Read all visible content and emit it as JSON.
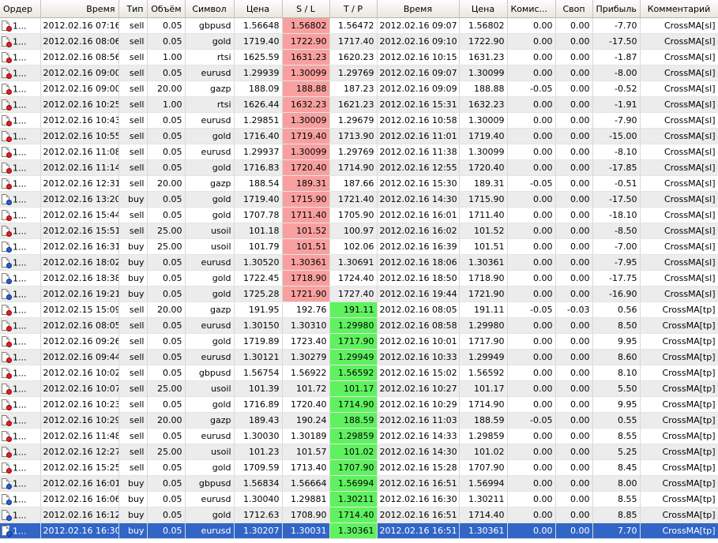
{
  "columns": {
    "order": "Ордер",
    "open_time": "Время",
    "type": "Тип",
    "volume": "Объём",
    "symbol": "Символ",
    "open_price": "Цена",
    "sl": "S / L",
    "tp": "T / P",
    "close_time": "Время",
    "close_price": "Цена",
    "commission": "Комис...",
    "swap": "Своп",
    "profit": "Прибыль",
    "comment": "Комментарий"
  },
  "colors": {
    "sl_hit": "#f8a0a0",
    "tp_hit": "#5ff25f",
    "selected_row": "#3165c6",
    "sell_icon": "#e02020",
    "buy_icon": "#2060e0"
  },
  "rows": [
    {
      "order": "1...",
      "open_time": "2012.02.16 07:16",
      "type": "sell",
      "volume": "0.05",
      "symbol": "gbpusd",
      "open_price": "1.56648",
      "sl": "1.56802",
      "tp": "1.56472",
      "close_time": "2012.02.16 09:07",
      "close_price": "1.56802",
      "commission": "0.00",
      "swap": "0.00",
      "profit": "-7.70",
      "comment": "CrossMA[sl]",
      "hit": "sl"
    },
    {
      "order": "1...",
      "open_time": "2012.02.16 08:06",
      "type": "sell",
      "volume": "0.05",
      "symbol": "gold",
      "open_price": "1719.40",
      "sl": "1722.90",
      "tp": "1717.40",
      "close_time": "2012.02.16 09:10",
      "close_price": "1722.90",
      "commission": "0.00",
      "swap": "0.00",
      "profit": "-17.50",
      "comment": "CrossMA[sl]",
      "hit": "sl"
    },
    {
      "order": "1...",
      "open_time": "2012.02.16 08:56",
      "type": "sell",
      "volume": "1.00",
      "symbol": "rtsi",
      "open_price": "1625.59",
      "sl": "1631.23",
      "tp": "1620.23",
      "close_time": "2012.02.16 10:15",
      "close_price": "1631.23",
      "commission": "0.00",
      "swap": "0.00",
      "profit": "-1.87",
      "comment": "CrossMA[sl]",
      "hit": "sl"
    },
    {
      "order": "1...",
      "open_time": "2012.02.16 09:00",
      "type": "sell",
      "volume": "0.05",
      "symbol": "eurusd",
      "open_price": "1.29939",
      "sl": "1.30099",
      "tp": "1.29769",
      "close_time": "2012.02.16 09:07",
      "close_price": "1.30099",
      "commission": "0.00",
      "swap": "0.00",
      "profit": "-8.00",
      "comment": "CrossMA[sl]",
      "hit": "sl"
    },
    {
      "order": "1...",
      "open_time": "2012.02.16 09:00",
      "type": "sell",
      "volume": "20.00",
      "symbol": "gazp",
      "open_price": "188.09",
      "sl": "188.88",
      "tp": "187.23",
      "close_time": "2012.02.16 09:09",
      "close_price": "188.88",
      "commission": "-0.05",
      "swap": "0.00",
      "profit": "-0.52",
      "comment": "CrossMA[sl]",
      "hit": "sl"
    },
    {
      "order": "1...",
      "open_time": "2012.02.16 10:25",
      "type": "sell",
      "volume": "1.00",
      "symbol": "rtsi",
      "open_price": "1626.44",
      "sl": "1632.23",
      "tp": "1621.23",
      "close_time": "2012.02.16 15:31",
      "close_price": "1632.23",
      "commission": "0.00",
      "swap": "0.00",
      "profit": "-1.91",
      "comment": "CrossMA[sl]",
      "hit": "sl"
    },
    {
      "order": "1...",
      "open_time": "2012.02.16 10:43",
      "type": "sell",
      "volume": "0.05",
      "symbol": "eurusd",
      "open_price": "1.29851",
      "sl": "1.30009",
      "tp": "1.29679",
      "close_time": "2012.02.16 10:58",
      "close_price": "1.30009",
      "commission": "0.00",
      "swap": "0.00",
      "profit": "-7.90",
      "comment": "CrossMA[sl]",
      "hit": "sl"
    },
    {
      "order": "1...",
      "open_time": "2012.02.16 10:55",
      "type": "sell",
      "volume": "0.05",
      "symbol": "gold",
      "open_price": "1716.40",
      "sl": "1719.40",
      "tp": "1713.90",
      "close_time": "2012.02.16 11:01",
      "close_price": "1719.40",
      "commission": "0.00",
      "swap": "0.00",
      "profit": "-15.00",
      "comment": "CrossMA[sl]",
      "hit": "sl"
    },
    {
      "order": "1...",
      "open_time": "2012.02.16 11:08",
      "type": "sell",
      "volume": "0.05",
      "symbol": "eurusd",
      "open_price": "1.29937",
      "sl": "1.30099",
      "tp": "1.29769",
      "close_time": "2012.02.16 11:38",
      "close_price": "1.30099",
      "commission": "0.00",
      "swap": "0.00",
      "profit": "-8.10",
      "comment": "CrossMA[sl]",
      "hit": "sl"
    },
    {
      "order": "1...",
      "open_time": "2012.02.16 11:14",
      "type": "sell",
      "volume": "0.05",
      "symbol": "gold",
      "open_price": "1716.83",
      "sl": "1720.40",
      "tp": "1714.90",
      "close_time": "2012.02.16 12:55",
      "close_price": "1720.40",
      "commission": "0.00",
      "swap": "0.00",
      "profit": "-17.85",
      "comment": "CrossMA[sl]",
      "hit": "sl"
    },
    {
      "order": "1...",
      "open_time": "2012.02.16 12:31",
      "type": "sell",
      "volume": "20.00",
      "symbol": "gazp",
      "open_price": "188.54",
      "sl": "189.31",
      "tp": "187.66",
      "close_time": "2012.02.16 15:30",
      "close_price": "189.31",
      "commission": "-0.05",
      "swap": "0.00",
      "profit": "-0.51",
      "comment": "CrossMA[sl]",
      "hit": "sl"
    },
    {
      "order": "1...",
      "open_time": "2012.02.16 13:20",
      "type": "buy",
      "volume": "0.05",
      "symbol": "gold",
      "open_price": "1719.40",
      "sl": "1715.90",
      "tp": "1721.40",
      "close_time": "2012.02.16 14:30",
      "close_price": "1715.90",
      "commission": "0.00",
      "swap": "0.00",
      "profit": "-17.50",
      "comment": "CrossMA[sl]",
      "hit": "sl"
    },
    {
      "order": "1...",
      "open_time": "2012.02.16 15:44",
      "type": "sell",
      "volume": "0.05",
      "symbol": "gold",
      "open_price": "1707.78",
      "sl": "1711.40",
      "tp": "1705.90",
      "close_time": "2012.02.16 16:01",
      "close_price": "1711.40",
      "commission": "0.00",
      "swap": "0.00",
      "profit": "-18.10",
      "comment": "CrossMA[sl]",
      "hit": "sl"
    },
    {
      "order": "1...",
      "open_time": "2012.02.16 15:51",
      "type": "sell",
      "volume": "25.00",
      "symbol": "usoil",
      "open_price": "101.18",
      "sl": "101.52",
      "tp": "100.97",
      "close_time": "2012.02.16 16:02",
      "close_price": "101.52",
      "commission": "0.00",
      "swap": "0.00",
      "profit": "-8.50",
      "comment": "CrossMA[sl]",
      "hit": "sl"
    },
    {
      "order": "1...",
      "open_time": "2012.02.16 16:31",
      "type": "buy",
      "volume": "25.00",
      "symbol": "usoil",
      "open_price": "101.79",
      "sl": "101.51",
      "tp": "102.06",
      "close_time": "2012.02.16 16:39",
      "close_price": "101.51",
      "commission": "0.00",
      "swap": "0.00",
      "profit": "-7.00",
      "comment": "CrossMA[sl]",
      "hit": "sl"
    },
    {
      "order": "1...",
      "open_time": "2012.02.16 18:02",
      "type": "buy",
      "volume": "0.05",
      "symbol": "eurusd",
      "open_price": "1.30520",
      "sl": "1.30361",
      "tp": "1.30691",
      "close_time": "2012.02.16 18:06",
      "close_price": "1.30361",
      "commission": "0.00",
      "swap": "0.00",
      "profit": "-7.95",
      "comment": "CrossMA[sl]",
      "hit": "sl"
    },
    {
      "order": "1...",
      "open_time": "2012.02.16 18:38",
      "type": "buy",
      "volume": "0.05",
      "symbol": "gold",
      "open_price": "1722.45",
      "sl": "1718.90",
      "tp": "1724.40",
      "close_time": "2012.02.16 18:50",
      "close_price": "1718.90",
      "commission": "0.00",
      "swap": "0.00",
      "profit": "-17.75",
      "comment": "CrossMA[sl]",
      "hit": "sl"
    },
    {
      "order": "1...",
      "open_time": "2012.02.16 19:21",
      "type": "buy",
      "volume": "0.05",
      "symbol": "gold",
      "open_price": "1725.28",
      "sl": "1721.90",
      "tp": "1727.40",
      "close_time": "2012.02.16 19:44",
      "close_price": "1721.90",
      "commission": "0.00",
      "swap": "0.00",
      "profit": "-16.90",
      "comment": "CrossMA[sl]",
      "hit": "sl"
    },
    {
      "order": "1...",
      "open_time": "2012.02.15 15:09",
      "type": "sell",
      "volume": "20.00",
      "symbol": "gazp",
      "open_price": "191.95",
      "sl": "192.76",
      "tp": "191.11",
      "close_time": "2012.02.16 08:05",
      "close_price": "191.11",
      "commission": "-0.05",
      "swap": "-0.03",
      "profit": "0.56",
      "comment": "CrossMA[tp]",
      "hit": "tp"
    },
    {
      "order": "1...",
      "open_time": "2012.02.16 08:05",
      "type": "sell",
      "volume": "0.05",
      "symbol": "eurusd",
      "open_price": "1.30150",
      "sl": "1.30310",
      "tp": "1.29980",
      "close_time": "2012.02.16 08:58",
      "close_price": "1.29980",
      "commission": "0.00",
      "swap": "0.00",
      "profit": "8.50",
      "comment": "CrossMA[tp]",
      "hit": "tp"
    },
    {
      "order": "1...",
      "open_time": "2012.02.16 09:26",
      "type": "sell",
      "volume": "0.05",
      "symbol": "gold",
      "open_price": "1719.89",
      "sl": "1723.40",
      "tp": "1717.90",
      "close_time": "2012.02.16 10:01",
      "close_price": "1717.90",
      "commission": "0.00",
      "swap": "0.00",
      "profit": "9.95",
      "comment": "CrossMA[tp]",
      "hit": "tp"
    },
    {
      "order": "1...",
      "open_time": "2012.02.16 09:44",
      "type": "sell",
      "volume": "0.05",
      "symbol": "eurusd",
      "open_price": "1.30121",
      "sl": "1.30279",
      "tp": "1.29949",
      "close_time": "2012.02.16 10:33",
      "close_price": "1.29949",
      "commission": "0.00",
      "swap": "0.00",
      "profit": "8.60",
      "comment": "CrossMA[tp]",
      "hit": "tp"
    },
    {
      "order": "1...",
      "open_time": "2012.02.16 10:02",
      "type": "sell",
      "volume": "0.05",
      "symbol": "gbpusd",
      "open_price": "1.56754",
      "sl": "1.56922",
      "tp": "1.56592",
      "close_time": "2012.02.16 15:02",
      "close_price": "1.56592",
      "commission": "0.00",
      "swap": "0.00",
      "profit": "8.10",
      "comment": "CrossMA[tp]",
      "hit": "tp"
    },
    {
      "order": "1...",
      "open_time": "2012.02.16 10:07",
      "type": "sell",
      "volume": "25.00",
      "symbol": "usoil",
      "open_price": "101.39",
      "sl": "101.72",
      "tp": "101.17",
      "close_time": "2012.02.16 10:27",
      "close_price": "101.17",
      "commission": "0.00",
      "swap": "0.00",
      "profit": "5.50",
      "comment": "CrossMA[tp]",
      "hit": "tp"
    },
    {
      "order": "1...",
      "open_time": "2012.02.16 10:23",
      "type": "sell",
      "volume": "0.05",
      "symbol": "gold",
      "open_price": "1716.89",
      "sl": "1720.40",
      "tp": "1714.90",
      "close_time": "2012.02.16 10:29",
      "close_price": "1714.90",
      "commission": "0.00",
      "swap": "0.00",
      "profit": "9.95",
      "comment": "CrossMA[tp]",
      "hit": "tp"
    },
    {
      "order": "1...",
      "open_time": "2012.02.16 10:29",
      "type": "sell",
      "volume": "20.00",
      "symbol": "gazp",
      "open_price": "189.43",
      "sl": "190.24",
      "tp": "188.59",
      "close_time": "2012.02.16 11:03",
      "close_price": "188.59",
      "commission": "-0.05",
      "swap": "0.00",
      "profit": "0.55",
      "comment": "CrossMA[tp]",
      "hit": "tp"
    },
    {
      "order": "1...",
      "open_time": "2012.02.16 11:48",
      "type": "sell",
      "volume": "0.05",
      "symbol": "eurusd",
      "open_price": "1.30030",
      "sl": "1.30189",
      "tp": "1.29859",
      "close_time": "2012.02.16 14:33",
      "close_price": "1.29859",
      "commission": "0.00",
      "swap": "0.00",
      "profit": "8.55",
      "comment": "CrossMA[tp]",
      "hit": "tp"
    },
    {
      "order": "1...",
      "open_time": "2012.02.16 12:27",
      "type": "sell",
      "volume": "25.00",
      "symbol": "usoil",
      "open_price": "101.23",
      "sl": "101.57",
      "tp": "101.02",
      "close_time": "2012.02.16 14:30",
      "close_price": "101.02",
      "commission": "0.00",
      "swap": "0.00",
      "profit": "5.25",
      "comment": "CrossMA[tp]",
      "hit": "tp"
    },
    {
      "order": "1...",
      "open_time": "2012.02.16 15:25",
      "type": "sell",
      "volume": "0.05",
      "symbol": "gold",
      "open_price": "1709.59",
      "sl": "1713.40",
      "tp": "1707.90",
      "close_time": "2012.02.16 15:28",
      "close_price": "1707.90",
      "commission": "0.00",
      "swap": "0.00",
      "profit": "8.45",
      "comment": "CrossMA[tp]",
      "hit": "tp"
    },
    {
      "order": "1...",
      "open_time": "2012.02.16 16:01",
      "type": "buy",
      "volume": "0.05",
      "symbol": "gbpusd",
      "open_price": "1.56834",
      "sl": "1.56664",
      "tp": "1.56994",
      "close_time": "2012.02.16 16:51",
      "close_price": "1.56994",
      "commission": "0.00",
      "swap": "0.00",
      "profit": "8.00",
      "comment": "CrossMA[tp]",
      "hit": "tp"
    },
    {
      "order": "1...",
      "open_time": "2012.02.16 16:06",
      "type": "buy",
      "volume": "0.05",
      "symbol": "eurusd",
      "open_price": "1.30040",
      "sl": "1.29881",
      "tp": "1.30211",
      "close_time": "2012.02.16 16:30",
      "close_price": "1.30211",
      "commission": "0.00",
      "swap": "0.00",
      "profit": "8.55",
      "comment": "CrossMA[tp]",
      "hit": "tp"
    },
    {
      "order": "1...",
      "open_time": "2012.02.16 16:12",
      "type": "buy",
      "volume": "0.05",
      "symbol": "gold",
      "open_price": "1712.63",
      "sl": "1708.90",
      "tp": "1714.40",
      "close_time": "2012.02.16 16:51",
      "close_price": "1714.40",
      "commission": "0.00",
      "swap": "0.00",
      "profit": "8.85",
      "comment": "CrossMA[tp]",
      "hit": "tp"
    },
    {
      "order": "1...",
      "open_time": "2012.02.16 16:30",
      "type": "buy",
      "volume": "0.05",
      "symbol": "eurusd",
      "open_price": "1.30207",
      "sl": "1.30031",
      "tp": "1.30361",
      "close_time": "2012.02.16 16:51",
      "close_price": "1.30361",
      "commission": "0.00",
      "swap": "0.00",
      "profit": "7.70",
      "comment": "CrossMA[tp]",
      "hit": "tp",
      "selected": true
    }
  ]
}
